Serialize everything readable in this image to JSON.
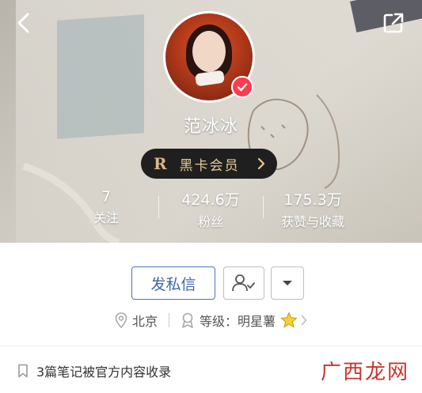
{
  "header": {
    "back_icon": "chevron-left-icon",
    "share_icon": "share-external-icon"
  },
  "profile": {
    "avatar_icon": "avatar",
    "verified_icon": "verified-check-icon",
    "name": "范冰冰",
    "vip": {
      "emblem": "R",
      "label": "黑卡会员",
      "chevron_icon": "chevron-right-icon"
    }
  },
  "stats": [
    {
      "value": "7",
      "label": "关注"
    },
    {
      "value": "424.6万",
      "label": "粉丝"
    },
    {
      "value": "175.3万",
      "label": "获赞与收藏"
    }
  ],
  "actions": {
    "message_label": "发私信",
    "follow_icon": "user-check-icon",
    "more_icon": "caret-down-icon"
  },
  "info": {
    "location": "北京",
    "level_label": "等级：",
    "level_value": "明星薯",
    "location_icon": "location-pin-icon",
    "level_icon": "badge-icon",
    "level_star_icon": "star-icon"
  },
  "notice": {
    "text": "3篇笔记被官方内容收录",
    "icon": "bookmark-icon"
  },
  "watermark": {
    "text": "广西龙网"
  },
  "colors": {
    "accent_blue": "#3f66ad",
    "verified_red": "#ff3b4e",
    "vip_gold": "#e8c893",
    "watermark_red": "#c8362e"
  }
}
